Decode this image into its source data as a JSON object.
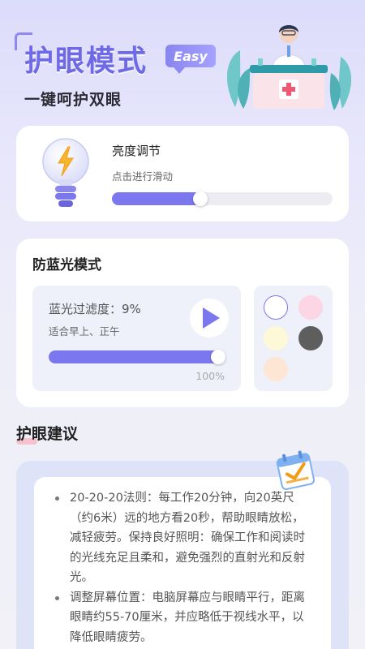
{
  "header": {
    "title": "护眼模式",
    "badge": "Easy",
    "subtitle": "一键呵护双眼",
    "illustration": "doctor-pharmacy-icon"
  },
  "brightness": {
    "icon": "lightbulb-icon",
    "title": "亮度调节",
    "hint": "点击进行滑动",
    "level": 0.4
  },
  "blue_light": {
    "title": "防蓝光模式",
    "filter_text": "蓝光过滤度：9%",
    "time_hint": "适合早上、正午",
    "play_icon": "play-icon",
    "progress": 1.0,
    "progress_label": "100%",
    "swatches": [
      {
        "name": "white",
        "color": "#ffffff"
      },
      {
        "name": "pink",
        "color": "#fcd6e4"
      },
      {
        "name": "cream",
        "color": "#fdf8d8"
      },
      {
        "name": "dark-gray",
        "color": "#5e5e5e"
      },
      {
        "name": "peach",
        "color": "#fde6d4"
      }
    ]
  },
  "advice": {
    "title": "护眼建议",
    "icon": "calendar-check-icon",
    "items": [
      "20-20-20法则：每工作20分钟，向20英尺（约6米）远的地方看20秒，帮助眼睛放松，减轻疲劳。保持良好照明：确保工作和阅读时的光线充足且柔和，避免强烈的直射光和反射光。",
      "调整屏幕位置：电脑屏幕应与眼睛平行，距离眼睛约55-70厘米，并应略低于视线水平，以降低眼睛疲劳。"
    ]
  },
  "colors": {
    "accent": "#7b77ee",
    "title": "#6e69e6"
  }
}
